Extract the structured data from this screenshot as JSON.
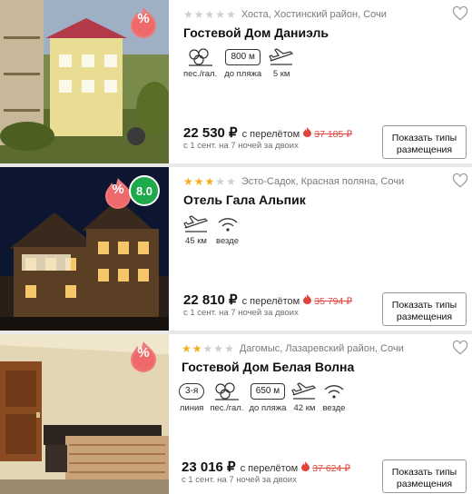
{
  "colors": {
    "accent_red": "#e2453b",
    "star": "#f2b01e",
    "rating_green": "#1ea94b",
    "divider": "#e9e9e9"
  },
  "hotels": [
    {
      "stars": 0,
      "location": "Хоста, Хостинский район, Сочи",
      "name": "Гостевой Дом Даниэль",
      "sale_badge": "%",
      "amenities": [
        {
          "icon": "beach-sand-icon",
          "label": "пес./гал."
        },
        {
          "icon": "distance-box",
          "value": "800 м",
          "label": "до пляжа"
        },
        {
          "icon": "plane-icon",
          "label": "5 км"
        }
      ],
      "price": "22 530 ₽",
      "price_note": "с перелётом",
      "old_price": "37 185 ₽",
      "dates": "с 1 сент. на 7 ночей за двоих",
      "button": "Показать типы размещения"
    },
    {
      "stars": 3,
      "location": "Эсто-Садок, Красная поляна, Сочи",
      "name": "Отель Гала Альпик",
      "sale_badge": "%",
      "rating": "8.0",
      "amenities": [
        {
          "icon": "plane-icon",
          "label": "45 км"
        },
        {
          "icon": "wifi-icon",
          "label": "везде"
        }
      ],
      "price": "22 810 ₽",
      "price_note": "с перелётом",
      "old_price": "35 794 ₽",
      "dates": "с 1 сент. на 7 ночей за двоих",
      "button": "Показать типы размещения"
    },
    {
      "stars": 2,
      "location": "Дагомыс, Лазаревский район, Сочи",
      "name": "Гостевой Дом Белая Волна",
      "sale_badge": "%",
      "amenities": [
        {
          "icon": "line-oval",
          "value": "3-я",
          "label": "линия"
        },
        {
          "icon": "beach-sand-icon",
          "label": "пес./гал."
        },
        {
          "icon": "distance-box",
          "value": "650 м",
          "label": "до пляжа"
        },
        {
          "icon": "plane-icon",
          "label": "42 км"
        },
        {
          "icon": "wifi-icon",
          "label": "везде"
        }
      ],
      "price": "23 016 ₽",
      "price_note": "с перелётом",
      "old_price": "37 624 ₽",
      "dates": "с 1 сент. на 7 ночей за двоих",
      "button": "Показать типы размещения"
    }
  ]
}
